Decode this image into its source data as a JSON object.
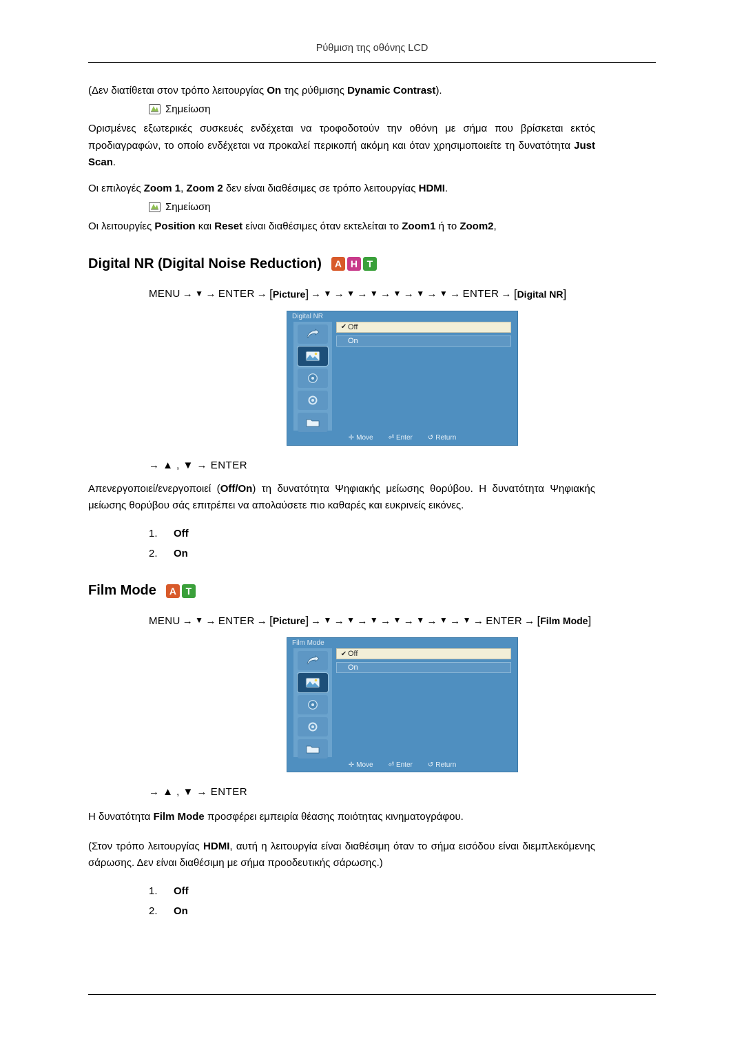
{
  "header": {
    "title": "Ρύθμιση της οθόνης LCD"
  },
  "intro": {
    "line1_pre": "(Δεν διατίθεται στον τρόπο λειτουργίας ",
    "line1_b1": "On",
    "line1_mid": " της ρύθμισης ",
    "line1_b2": "Dynamic Contrast",
    "line1_post": ")."
  },
  "note_label_1": "Σημείωση",
  "note_label_2": "Σημείωση",
  "para1": {
    "t1": "Ορισμένες εξωτερικές συσκευές ενδέχεται να τροφοδοτούν την οθόνη με σήμα που βρίσκεται εκτός προδιαγραφών, το οποίο ενδέχεται να προκαλεί περικοπή ακόμη και όταν χρησιμοποιείτε τη δυνατότητα ",
    "b1": "Just Scan",
    "t2": "."
  },
  "para2": {
    "t1": "Οι επιλογές ",
    "b1": "Zoom 1",
    "t2": ", ",
    "b2": "Zoom 2",
    "t3": " δεν είναι διαθέσιμες σε τρόπο λειτουργίας ",
    "b3": "HDMI",
    "t4": "."
  },
  "para3": {
    "t1": "Οι λειτουργίες ",
    "b1": "Position",
    "t2": " και ",
    "b2": "Reset",
    "t3": " είναι διαθέσιμες όταν εκτελείται το ",
    "b3": "Zoom1",
    "t4": " ή το ",
    "b4": "Zoom2",
    "t5": ","
  },
  "section1": {
    "title": "Digital NR (Digital Noise Reduction)",
    "badges": [
      "A",
      "H",
      "T"
    ],
    "menu_path": {
      "start": "MENU",
      "enter1": "ENTER",
      "box1": "Picture",
      "enter2": "ENTER",
      "box2": "Digital NR",
      "down_count_1": 1,
      "mid_downs": 6
    },
    "osd": {
      "title": "Digital NR",
      "rows": [
        {
          "label": "Off",
          "checked": true,
          "highlight": true
        },
        {
          "label": "On",
          "checked": false,
          "highlight": false
        }
      ],
      "footer": [
        "Move",
        "Enter",
        "Return"
      ]
    },
    "sub_path": "→ ▲ , ▼ → ENTER",
    "description": {
      "t1": "Απενεργοποιεί/ενεργοποιεί  (",
      "b1": "Off/On",
      "t2": ")  τη  δυνατότητα  Ψηφιακής  μείωσης  θορύβου.  Η δυνατότητα Ψηφιακής μείωσης θορύβου σάς επιτρέπει να απολαύσετε πιο καθαρές και ευκρινείς εικόνες."
    },
    "options": [
      {
        "num": "1.",
        "label": "Off"
      },
      {
        "num": "2.",
        "label": "On"
      }
    ]
  },
  "section2": {
    "title": "Film Mode",
    "badges": [
      "A",
      "T"
    ],
    "menu_path": {
      "start": "MENU",
      "enter1": "ENTER",
      "box1": "Picture",
      "enter2": "ENTER",
      "box2": "Film Mode"
    },
    "osd": {
      "title": "Film Mode",
      "rows": [
        {
          "label": "Off",
          "checked": true,
          "highlight": true
        },
        {
          "label": "On",
          "checked": false,
          "highlight": false
        }
      ],
      "footer": [
        "Move",
        "Enter",
        "Return"
      ]
    },
    "sub_path": "→ ▲ , ▼ → ENTER",
    "description": {
      "t1": "Η δυνατότητα ",
      "b1": "Film Mode",
      "t2": " προσφέρει εμπειρία θέασης ποιότητας κινηματογράφου."
    },
    "description2": {
      "t1": "(Στον τρόπο λειτουργίας ",
      "b1": "HDMI",
      "t2": ", αυτή η λειτουργία είναι διαθέσιμη όταν το σήμα εισόδου είναι διεμπλεκόμενης σάρωσης. Δεν είναι διαθέσιμη με σήμα προοδευτικής σάρωσης.)"
    },
    "options": [
      {
        "num": "1.",
        "label": "Off"
      },
      {
        "num": "2.",
        "label": "On"
      }
    ]
  }
}
